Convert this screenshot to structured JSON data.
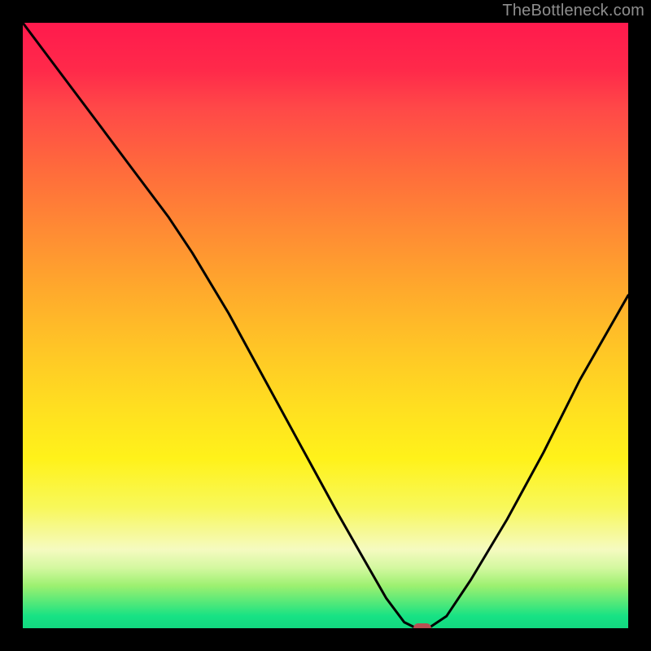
{
  "watermark": {
    "text": "TheBottleneck.com"
  },
  "colors": {
    "background": "#000000",
    "curve": "#000000",
    "marker": "#b84f52",
    "watermark": "#8e8e8e"
  },
  "chart_data": {
    "type": "line",
    "title": "",
    "xlabel": "",
    "ylabel": "",
    "xlim": [
      0,
      100
    ],
    "ylim": [
      0,
      100
    ],
    "grid": false,
    "legend": false,
    "series": [
      {
        "name": "bottleneck-curve",
        "x": [
          0,
          6,
          12,
          18,
          24,
          28,
          34,
          40,
          46,
          52,
          56,
          60,
          63,
          65,
          67,
          70,
          74,
          80,
          86,
          92,
          100
        ],
        "values": [
          100,
          92,
          84,
          76,
          68,
          62,
          52,
          41,
          30,
          19,
          12,
          5,
          1,
          0,
          0,
          2,
          8,
          18,
          29,
          41,
          55
        ]
      }
    ],
    "marker": {
      "name": "optimal-point",
      "x": 66,
      "y": 0
    }
  }
}
